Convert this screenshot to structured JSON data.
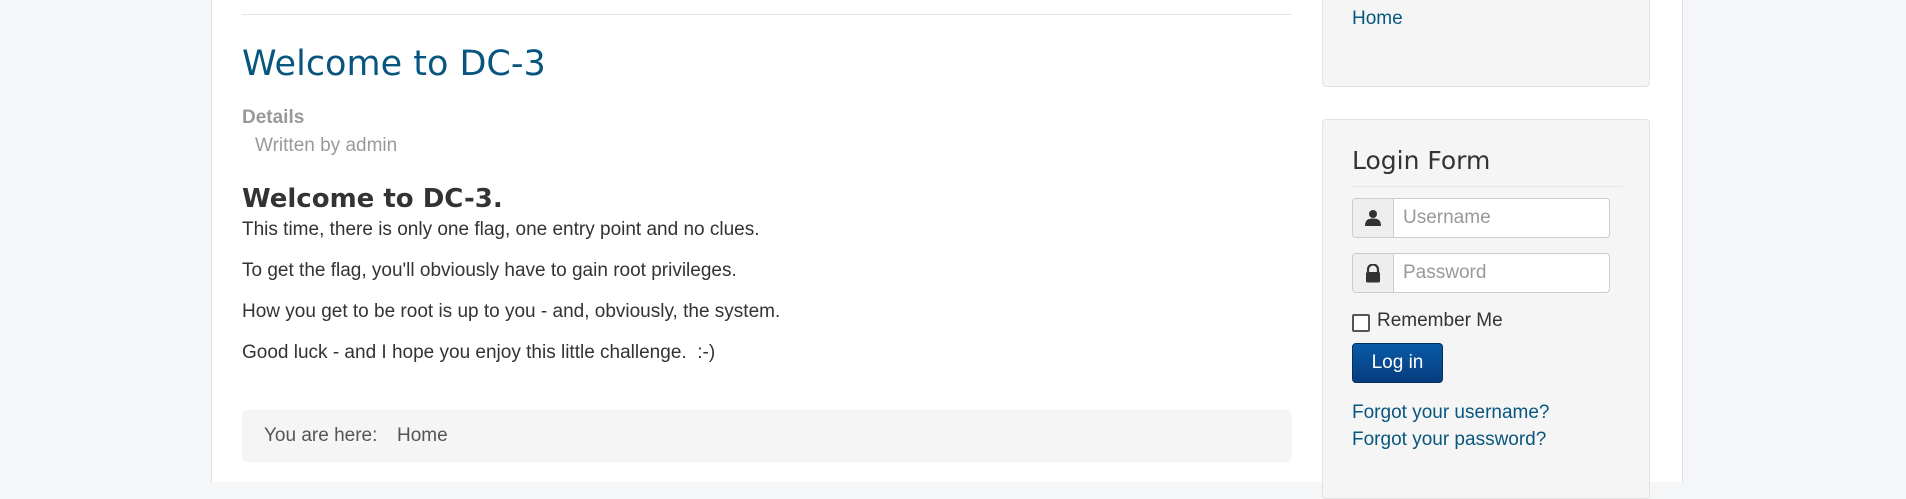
{
  "article": {
    "title": "Welcome to DC-3",
    "details_label": "Details",
    "author": "Written by admin",
    "subheading": "Welcome to DC-3.",
    "paragraphs": [
      "This time, there is only one flag, one entry point and no clues.",
      "To get the flag, you'll obviously have to gain root privileges.",
      "How you get to be root is up to you - and, obviously, the system.",
      "Good luck - and I hope you enjoy this little challenge.  :-)"
    ]
  },
  "breadcrumb": {
    "label": "You are here:",
    "item": "Home"
  },
  "menu": {
    "home": "Home"
  },
  "login": {
    "title": "Login Form",
    "username_placeholder": "Username",
    "password_placeholder": "Password",
    "remember_label": "Remember Me",
    "login_button": "Log in",
    "forgot_username": "Forgot your username?",
    "forgot_password": "Forgot your password?"
  },
  "icons": {
    "user": "user-icon",
    "lock": "lock-icon"
  },
  "colors": {
    "link": "#08567f",
    "button": "#063d7d",
    "muted": "#999999"
  }
}
